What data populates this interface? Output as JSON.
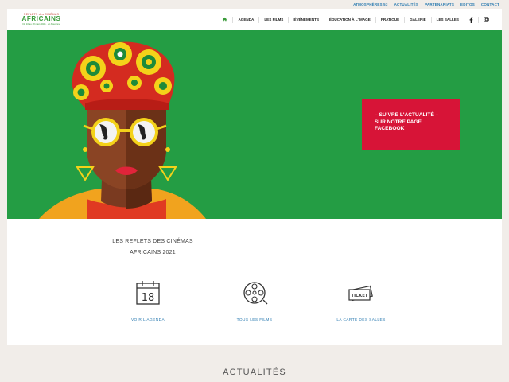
{
  "topbar": {
    "links": [
      "ATMOSPHÈRES 53",
      "ACTUALITÉS",
      "PARTENARIATS",
      "EDITOS",
      "CONTACT"
    ]
  },
  "logo": {
    "line1": "REFLETS des CINÉMAS",
    "line2": "AFRICAINS",
    "line3": "Du 10 au 28 mars 2021 · en Mayenne"
  },
  "nav": {
    "items": [
      "AGENDA",
      "LES FILMS",
      "ÉVÉNEMENTS",
      "ÉDUCATION À L'IMAGE",
      "PRATIQUE",
      "GALERIE",
      "LES SALLES"
    ],
    "home_icon": "home-icon",
    "social": [
      "facebook-icon",
      "instagram-icon"
    ]
  },
  "hero": {
    "cta_lines": [
      "– SUIVRE L'ACTUALITÉ –",
      "SUR NOTRE PAGE",
      "FACEBOOK"
    ],
    "background": "#249d44",
    "cta_color": "#d71437"
  },
  "intro": {
    "lines": [
      "LES REFLETS DES CINÉMAS",
      "AFRICAINS 2021"
    ]
  },
  "quick_links": [
    {
      "label": "VOIR L'AGENDA",
      "icon": "calendar-icon",
      "day": "18"
    },
    {
      "label": "TOUS LES FILMS",
      "icon": "film-reel-icon"
    },
    {
      "label": "LA CARTE DES SALLES",
      "icon": "ticket-icon",
      "ticket_text": "TICKET"
    }
  ],
  "news": {
    "title": "ACTUALITÉS"
  },
  "colors": {
    "link_blue": "#2a7ab0",
    "logo_green": "#3a9b3a"
  }
}
